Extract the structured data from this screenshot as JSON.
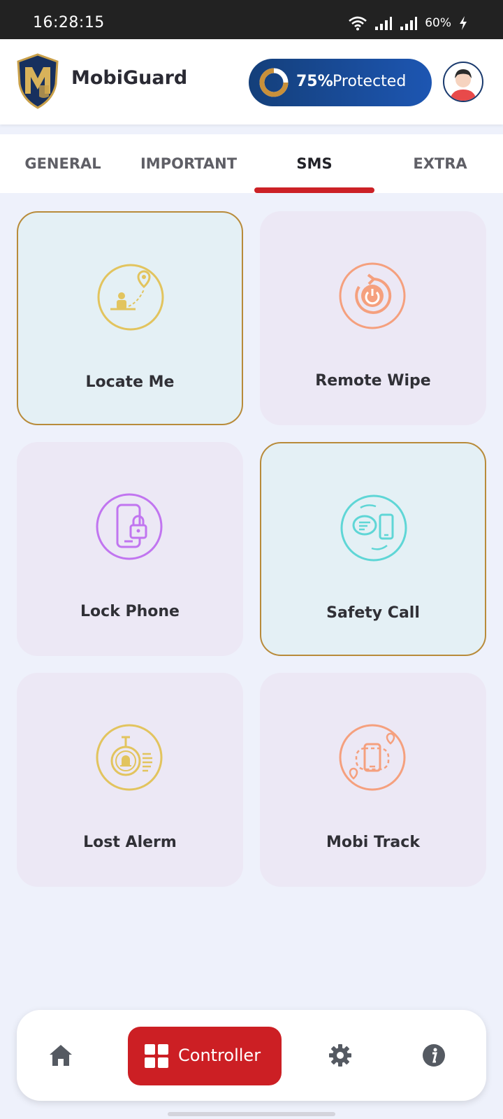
{
  "status_bar": {
    "time": "16:28:15",
    "battery": "60%"
  },
  "header": {
    "app_name": "MobiGuard",
    "protection_percent": "75%",
    "protection_label": "Protected"
  },
  "tabs": [
    {
      "label": "GENERAL",
      "active": false
    },
    {
      "label": "IMPORTANT",
      "active": false
    },
    {
      "label": "SMS",
      "active": true
    },
    {
      "label": "EXTRA",
      "active": false
    }
  ],
  "cards": [
    {
      "label": "Locate Me",
      "icon": "locate-icon",
      "selected": true,
      "color": "#e2c45e"
    },
    {
      "label": "Remote Wipe",
      "icon": "power-icon",
      "selected": false,
      "color": "#f5a07e"
    },
    {
      "label": "Lock Phone",
      "icon": "lock-phone-icon",
      "selected": false,
      "color": "#c175f0"
    },
    {
      "label": "Safety Call",
      "icon": "chat-phone-icon",
      "selected": true,
      "color": "#5fd6d6"
    },
    {
      "label": "Lost Alerm",
      "icon": "alarm-icon",
      "selected": false,
      "color": "#e2c45e"
    },
    {
      "label": "Mobi Track",
      "icon": "track-icon",
      "selected": false,
      "color": "#f5a07e"
    }
  ],
  "bottom_nav": {
    "controller_label": "Controller",
    "items": [
      "home-icon",
      "controller-icon",
      "gear-icon",
      "info-icon"
    ]
  },
  "colors": {
    "accent": "#cc1f24",
    "brand_blue": "#1d56b2",
    "gold": "#b88b3a"
  }
}
